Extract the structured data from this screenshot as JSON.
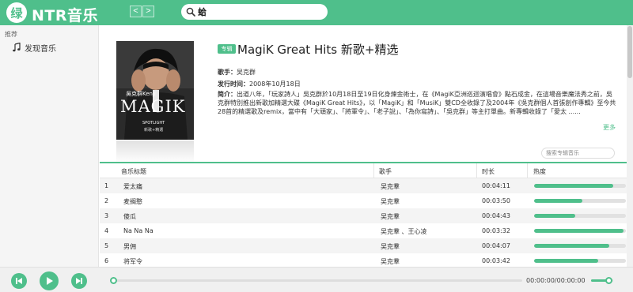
{
  "header": {
    "logo_char": "绿",
    "title": "NTR音乐",
    "back_glyph": "<",
    "forward_glyph": ">",
    "search_value": "蛤",
    "accent_color": "#4fbf8b"
  },
  "sidebar": {
    "heading": "推荐",
    "items": [
      {
        "icon": "music-note-icon",
        "label": "发现音乐"
      }
    ]
  },
  "album": {
    "badge": "专辑",
    "title": "MagiK Great Hits 新歌+精选",
    "artist_label": "歌手：",
    "artist": "吴克群",
    "release_label": "发行时间：",
    "release_date": "2008年10月18日",
    "intro_label": "简介：",
    "intro": "出道八年，「玩家詩人」吳克群於10月18日至19日化身煉金術士，在《MagiK亞洲巡迴演唱會》點石成金，在這場音樂魔法秀之前，吳克群特別推出新歌加精選大碟《MagiK Great Hits》，以「MagiK」和「MusiK」雙CD全收錄了及2004年《吳克群個人首張創作專輯》至今共28首的精選歌及remix，當中有「大頑家」、「將軍令」、「老子說」、「為你寫詩」、「吳克群」等主打單曲。新專輯收錄了「愛太 ......",
    "more": "更多",
    "search_placeholder": "搜索专辑音乐",
    "cover_texts": {
      "artist_line": "吳克群Kenji",
      "magik": "MAGIK",
      "sub1": "SPOTLIGHT",
      "sub2": "新歌+精選"
    }
  },
  "table": {
    "headers": [
      "音乐标题",
      "歌手",
      "时长",
      "热度"
    ],
    "rows": [
      {
        "index": "1",
        "title": "爱太痛",
        "artist": "吴克羣",
        "duration": "00:04:11",
        "heat": 0.86
      },
      {
        "index": "2",
        "title": "麦搁憨",
        "artist": "吴克羣",
        "duration": "00:03:50",
        "heat": 0.53
      },
      {
        "index": "3",
        "title": "傻瓜",
        "artist": "吴克羣",
        "duration": "00:04:43",
        "heat": 0.45
      },
      {
        "index": "4",
        "title": "Na Na Na",
        "artist": "吴克羣 、王心凌",
        "duration": "00:03:32",
        "heat": 0.97
      },
      {
        "index": "5",
        "title": "男佣",
        "artist": "吴克羣",
        "duration": "00:04:07",
        "heat": 0.82
      },
      {
        "index": "6",
        "title": "将军令",
        "artist": "吴克羣",
        "duration": "00:03:42",
        "heat": 0.7
      }
    ]
  },
  "player": {
    "time": "00:00:00/00:00:00",
    "volume": 0.7,
    "progress": 0
  }
}
